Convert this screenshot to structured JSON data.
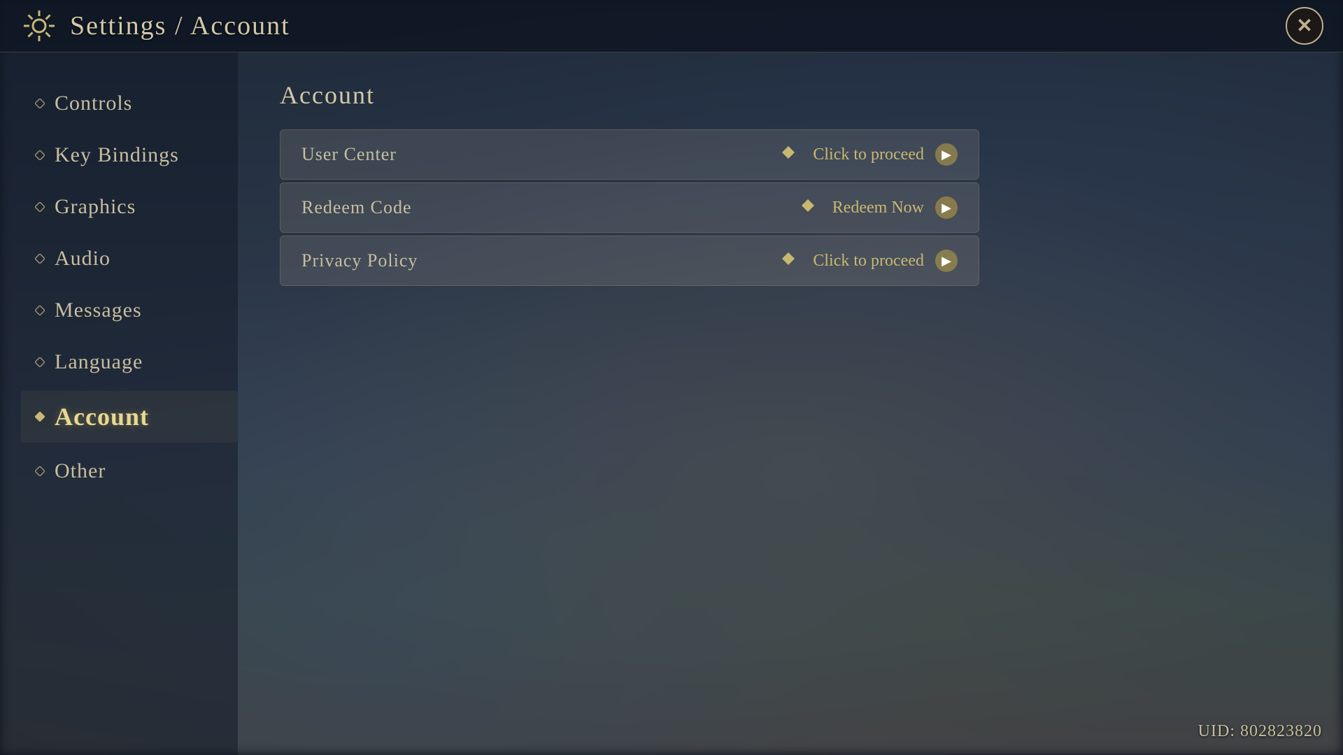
{
  "header": {
    "title": "Settings / Account",
    "close_label": "✕"
  },
  "sidebar": {
    "items": [
      {
        "id": "controls",
        "label": "Controls",
        "active": false
      },
      {
        "id": "key-bindings",
        "label": "Key Bindings",
        "active": false
      },
      {
        "id": "graphics",
        "label": "Graphics",
        "active": false
      },
      {
        "id": "audio",
        "label": "Audio",
        "active": false
      },
      {
        "id": "messages",
        "label": "Messages",
        "active": false
      },
      {
        "id": "language",
        "label": "Language",
        "active": false
      },
      {
        "id": "account",
        "label": "Account",
        "active": true
      },
      {
        "id": "other",
        "label": "Other",
        "active": false
      }
    ]
  },
  "main": {
    "title": "Account",
    "actions": [
      {
        "id": "user-center",
        "left_label": "User Center",
        "right_label": "Click to proceed"
      },
      {
        "id": "redeem-code",
        "left_label": "Redeem Code",
        "right_label": "Redeem Now"
      },
      {
        "id": "privacy-policy",
        "left_label": "Privacy Policy",
        "right_label": "Click to proceed"
      }
    ]
  },
  "footer": {
    "uid_label": "UID: 802823820"
  },
  "icons": {
    "settings": "gear",
    "close": "close",
    "arrow_right": "▶",
    "diamond": "◆",
    "diamond_outline": "◇"
  }
}
